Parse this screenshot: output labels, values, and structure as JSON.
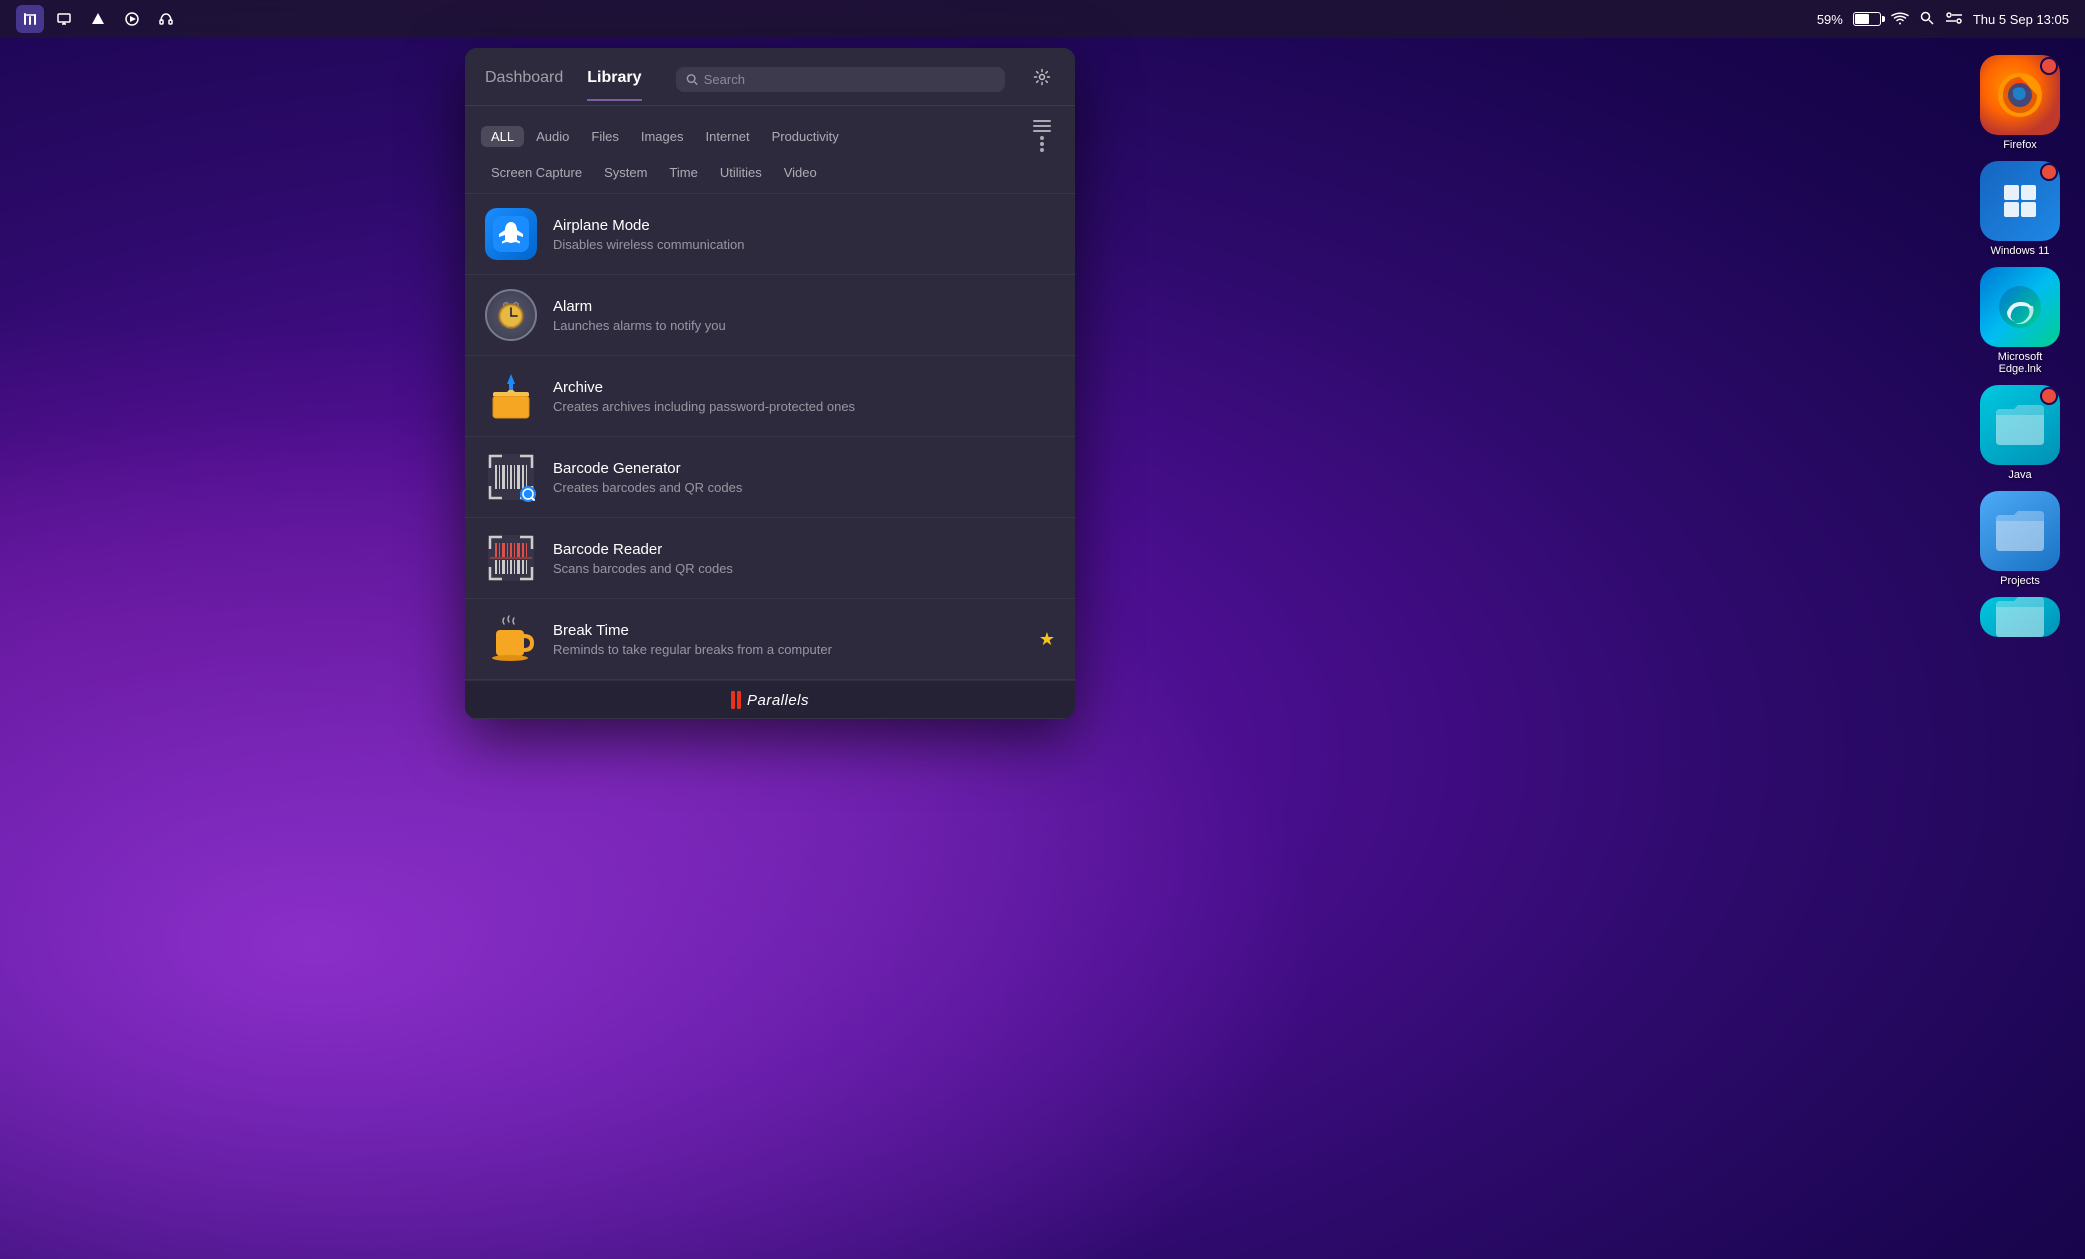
{
  "menubar": {
    "time": "Thu 5 Sep  13:05",
    "battery_percent": "59%",
    "icons": [
      "tools",
      "screen",
      "triangle",
      "play",
      "headphones"
    ]
  },
  "panel": {
    "tabs": [
      {
        "label": "Dashboard",
        "active": false
      },
      {
        "label": "Library",
        "active": true
      }
    ],
    "search_placeholder": "Search",
    "filter_tags": [
      {
        "label": "ALL",
        "active": true
      },
      {
        "label": "Audio",
        "active": false
      },
      {
        "label": "Files",
        "active": false
      },
      {
        "label": "Images",
        "active": false
      },
      {
        "label": "Internet",
        "active": false
      },
      {
        "label": "Productivity",
        "active": false
      },
      {
        "label": "Screen Capture",
        "active": false
      },
      {
        "label": "System",
        "active": false
      },
      {
        "label": "Time",
        "active": false
      },
      {
        "label": "Utilities",
        "active": false
      },
      {
        "label": "Video",
        "active": false
      }
    ],
    "items": [
      {
        "title": "Airplane Mode",
        "description": "Disables wireless communication",
        "icon_type": "airplane",
        "starred": false
      },
      {
        "title": "Alarm",
        "description": "Launches alarms to notify you",
        "icon_type": "alarm",
        "starred": false
      },
      {
        "title": "Archive",
        "description": "Creates archives including password-protected ones",
        "icon_type": "archive",
        "starred": false
      },
      {
        "title": "Barcode Generator",
        "description": "Creates barcodes and QR codes",
        "icon_type": "barcode_gen",
        "starred": false
      },
      {
        "title": "Barcode Reader",
        "description": "Scans barcodes and QR codes",
        "icon_type": "barcode_reader",
        "starred": false
      },
      {
        "title": "Break Time",
        "description": "Reminds to take regular breaks from a computer",
        "icon_type": "break_time",
        "starred": true
      }
    ],
    "footer_brand": "Parallels"
  },
  "dock": {
    "items": [
      {
        "label": "Firefox",
        "icon_type": "firefox"
      },
      {
        "label": "Windows 11",
        "icon_type": "win11"
      },
      {
        "label": "Microsoft Edge.lnk",
        "icon_type": "edge"
      },
      {
        "label": "Java",
        "icon_type": "folder_teal"
      },
      {
        "label": "Projects",
        "icon_type": "folder_blue"
      },
      {
        "label": "",
        "icon_type": "folder_teal2"
      }
    ]
  }
}
